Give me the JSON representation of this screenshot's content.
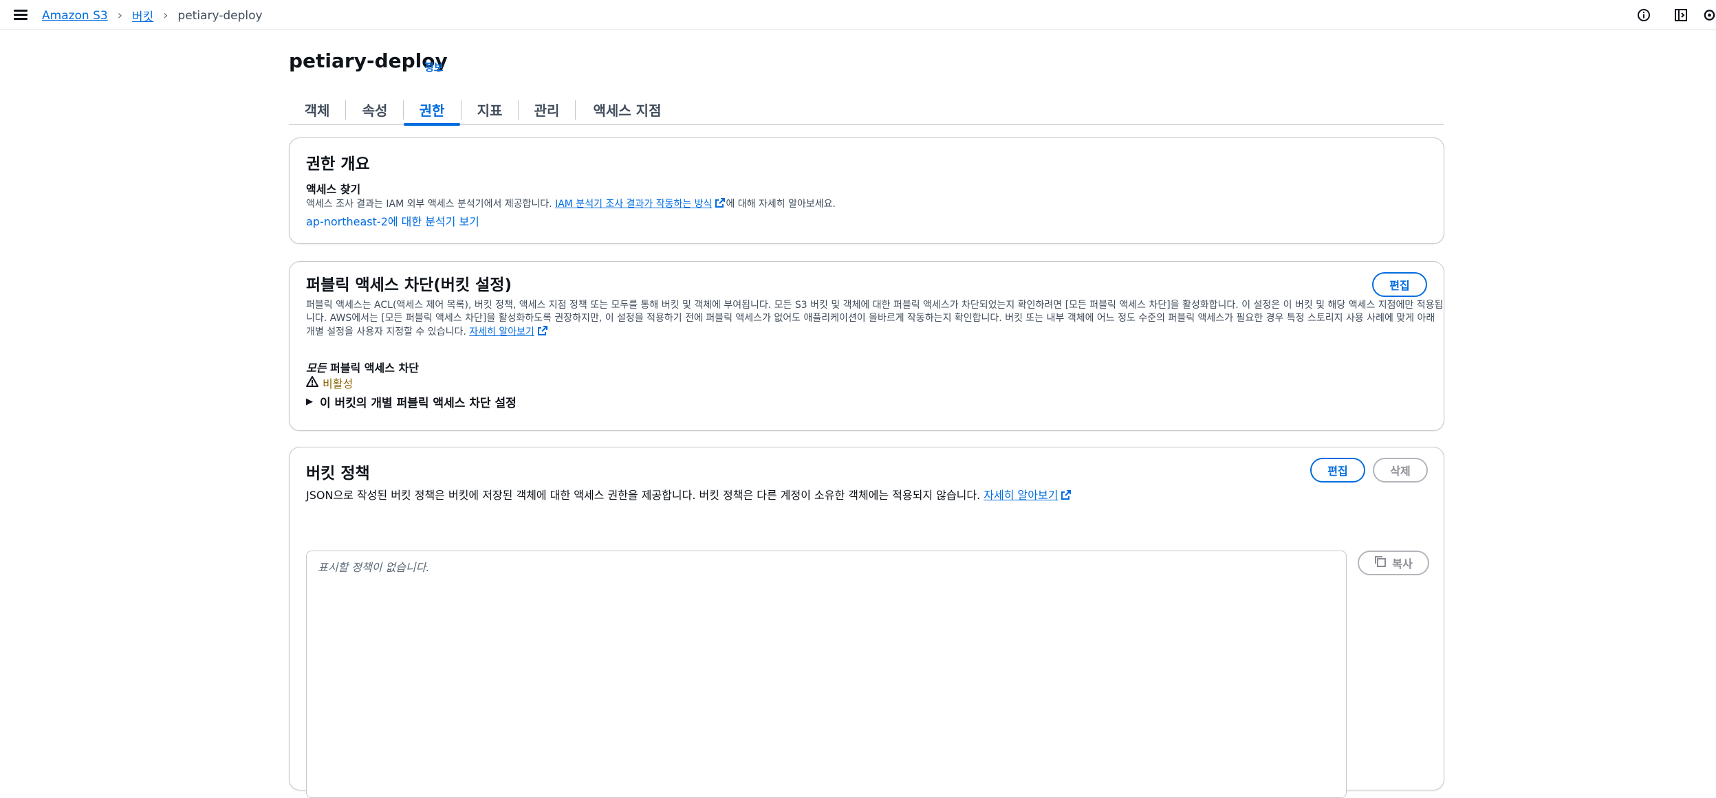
{
  "breadcrumb": {
    "items": [
      {
        "label": "Amazon S3"
      },
      {
        "label": "버킷"
      }
    ],
    "current": "petiary-deploy"
  },
  "header": {
    "title": "petiary-deploy",
    "info_label": "정보"
  },
  "tabs": [
    {
      "label": "객체",
      "active": false
    },
    {
      "label": "속성",
      "active": false
    },
    {
      "label": "권한",
      "active": true
    },
    {
      "label": "지표",
      "active": false
    },
    {
      "label": "관리",
      "active": false
    },
    {
      "label": "액세스 지점",
      "active": false
    }
  ],
  "overview": {
    "title": "권한 개요",
    "access_heading": "액세스 찾기",
    "desc_prefix": "액세스 조사 결과는 IAM 외부 액세스 분석기에서 제공합니다. ",
    "desc_link": "IAM 분석기 조사 결과가 작동하는 방식",
    "desc_suffix": "에 대해 자세히 알아보세요.",
    "analyzer_link": "ap-northeast-2에 대한 분석기 보기"
  },
  "block_public": {
    "title": "퍼블릭 액세스 차단(버킷 설정)",
    "edit_label": "편집",
    "line1": "퍼블릭 액세스는 ACL(액세스 제어 목록), 버킷 정책, 액세스 지점 정책 또는 모두를 통해 버킷 및 객체에 부여됩니다. 모든 S3 버킷 및 객체에 대한 퍼블릭 액세스가 차단되었는지 확인하려면 [모든 퍼블릭 액세스 차단]을 활성화합니다. 이 설정은 이 버킷 및 해당 액세스 지점에만 적용됩",
    "line2": "니다. AWS에서는 [모든 퍼블릭 액세스 차단]을 활성화하도록 권장하지만, 이 설정을 적용하기 전에 퍼블릭 액세스가 없어도 애플리케이션이 올바르게 작동하는지 확인합니다. 버킷 또는 내부 객체에 어느 정도 수준의 퍼블릭 액세스가 필요한 경우 특정 스토리지 사용 사례에 맞게 아래",
    "line3": "개별 설정을 사용자 지정할 수 있습니다. ",
    "learn_more": "자세히 알아보기",
    "block_all_italic": "모든",
    "block_all_rest": " 퍼블릭 액세스 차단",
    "status": "비활성",
    "status_color": "#8d6605",
    "expand_label": "이 버킷의 개별 퍼블릭 액세스 차단 설정"
  },
  "bucket_policy": {
    "title": "버킷 정책",
    "edit_label": "편집",
    "delete_label": "삭제",
    "desc": "JSON으로 작성된 버킷 정책은 버킷에 저장된 객체에 대한 액세스 권한을 제공합니다. 버킷 정책은 다른 계정이 소유한 객체에는 적용되지 않습니다. ",
    "learn_more": "자세히 알아보기",
    "empty_text": "표시할 정책이 없습니다.",
    "copy_label": "복사"
  },
  "colors": {
    "link": "#006ce0",
    "warning": "#8d6605",
    "border": "#c6c6cd"
  }
}
